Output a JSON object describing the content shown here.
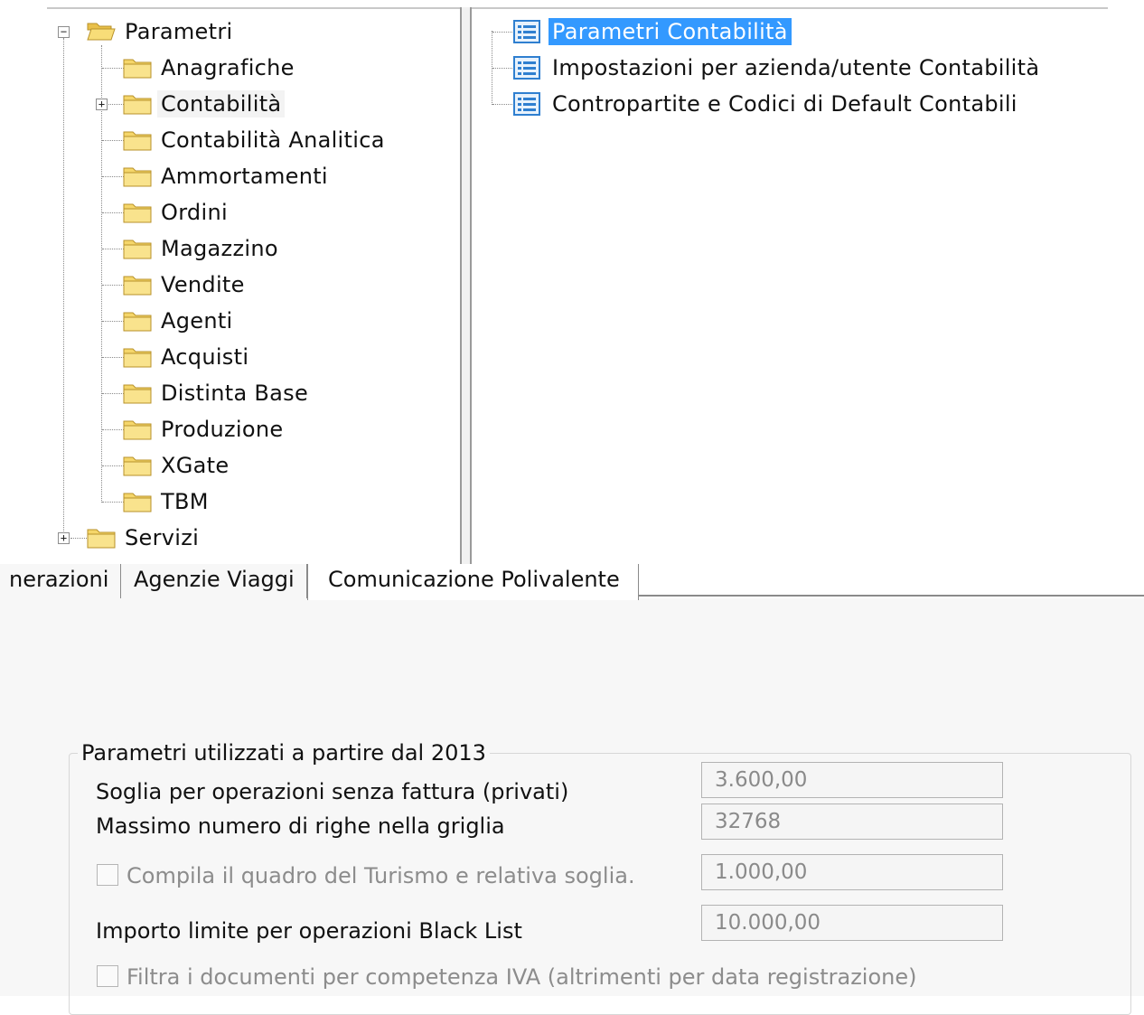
{
  "tree": {
    "root": {
      "label": "Parametri",
      "expander": "−"
    },
    "children": [
      {
        "label": "Anagrafiche"
      },
      {
        "label": "Contabilità",
        "expander": "+"
      },
      {
        "label": "Contabilità Analitica"
      },
      {
        "label": "Ammortamenti"
      },
      {
        "label": "Ordini"
      },
      {
        "label": "Magazzino"
      },
      {
        "label": "Vendite"
      },
      {
        "label": "Agenti"
      },
      {
        "label": "Acquisti"
      },
      {
        "label": "Distinta Base"
      },
      {
        "label": "Produzione"
      },
      {
        "label": "XGate"
      },
      {
        "label": "TBM"
      }
    ],
    "sibling": {
      "label": "Servizi",
      "expander": "+"
    }
  },
  "list": {
    "items": [
      {
        "label": "Parametri Contabilità"
      },
      {
        "label": "Impostazioni per azienda/utente Contabilità"
      },
      {
        "label": "Contropartite e Codici di Default Contabili"
      }
    ]
  },
  "tabs": [
    {
      "label": "nerazioni"
    },
    {
      "label": "Agenzie Viaggi"
    },
    {
      "label": "Comunicazione Polivalente"
    }
  ],
  "form": {
    "group_title": "Parametri utilizzati a partire dal 2013",
    "soglia_label": "Soglia per operazioni senza fattura (privati)",
    "soglia_value": "3.600,00",
    "righe_label": "Massimo numero di righe nella griglia",
    "righe_value": "32768",
    "turismo_label": "Compila il quadro del Turismo e relativa soglia.",
    "turismo_value": "1.000,00",
    "blacklist_label": "Importo limite per operazioni Black List",
    "blacklist_value": "10.000,00",
    "filtra_label": "Filtra i documenti per competenza IVA (altrimenti per data registrazione)"
  },
  "colors": {
    "selection": "#3399ff",
    "folder": "#f5d66a",
    "doc_icon": "#2f7fd0"
  }
}
